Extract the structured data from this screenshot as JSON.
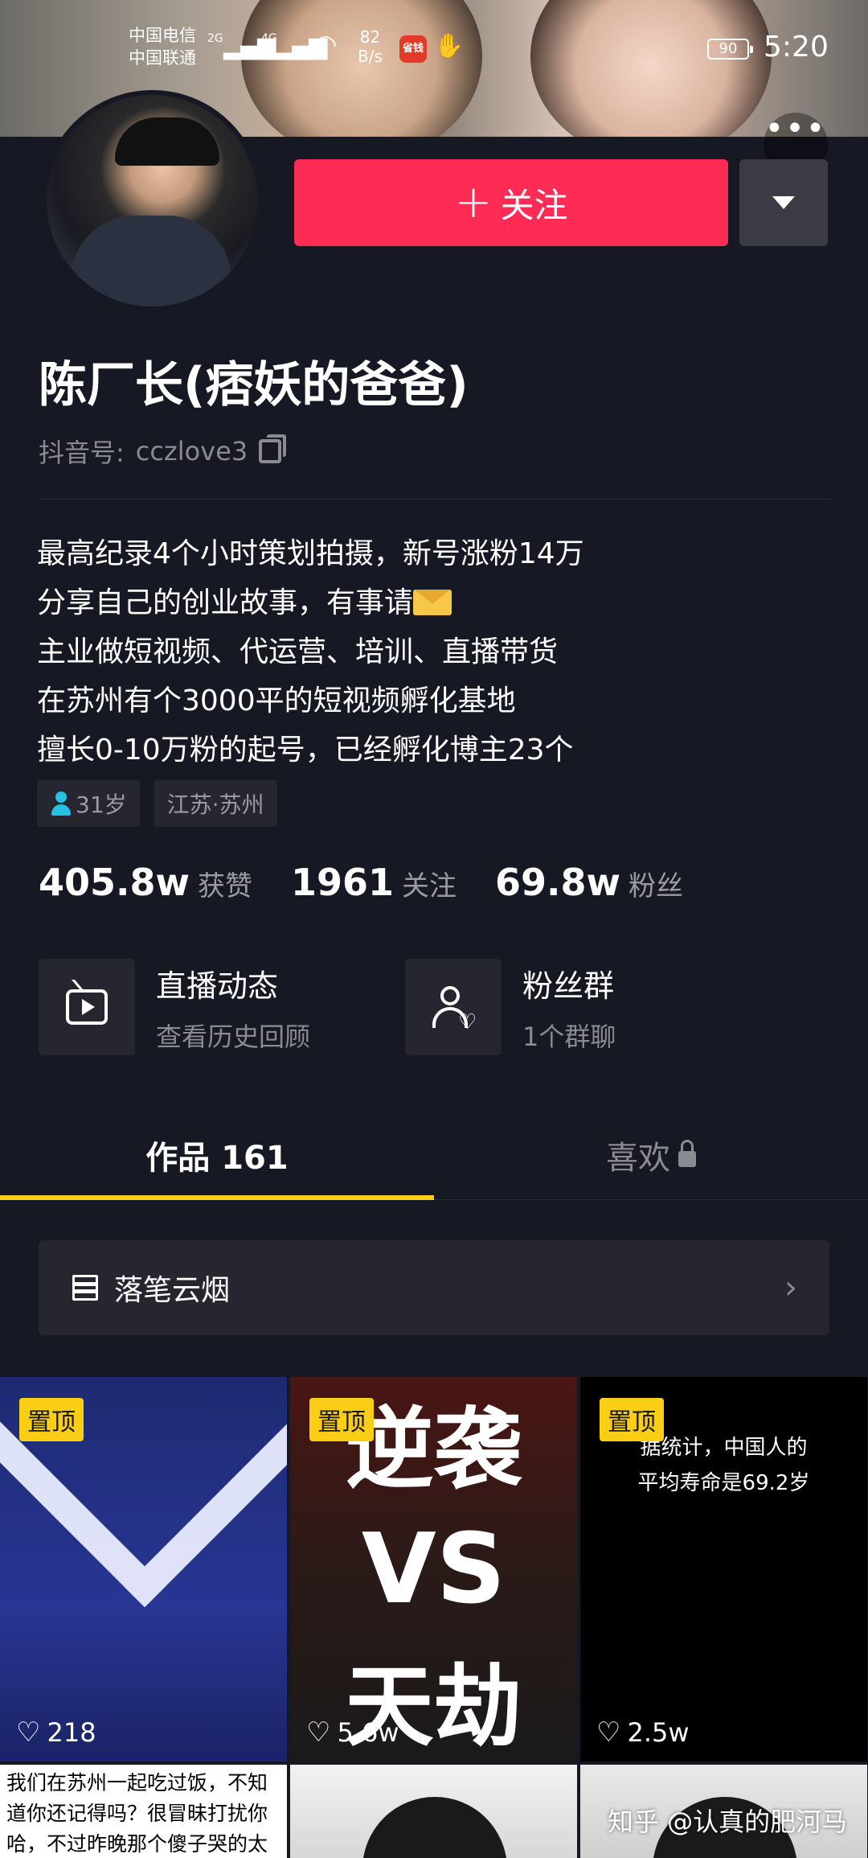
{
  "status_bar": {
    "carrier_1": "中国电信",
    "carrier_2": "中国联通",
    "net_1": "2G",
    "net_2": "4G",
    "speed_value": "82",
    "speed_unit": "B/s",
    "app_badge": "省钱",
    "battery": "90",
    "time": "5:20"
  },
  "profile": {
    "follow_label": "关注",
    "follow_plus": "+",
    "name": "陈厂长(痞妖的爸爸)",
    "douyin_id_label": "抖音号:",
    "douyin_id": "cczlove3",
    "bio": [
      "最高纪录4个小时策划拍摄，新号涨粉14万",
      "分享自己的创业故事，有事请",
      "主业做短视频、代运营、培训、直播带货",
      "在苏州有个3000平的短视频孵化基地",
      "擅长0-10万粉的起号，已经孵化博主23个"
    ],
    "tags": {
      "age": "31岁",
      "location": "江苏·苏州"
    },
    "stats": [
      {
        "value": "405.8w",
        "label": "获赞"
      },
      {
        "value": "1961",
        "label": "关注"
      },
      {
        "value": "69.8w",
        "label": "粉丝"
      }
    ],
    "features": [
      {
        "title": "直播动态",
        "subtitle": "查看历史回顾"
      },
      {
        "title": "粉丝群",
        "subtitle": "1个群聊"
      }
    ]
  },
  "tabs": {
    "works": "作品 161",
    "likes": "喜欢"
  },
  "collection": {
    "label": "落笔云烟"
  },
  "videos": [
    {
      "pinned": "置顶",
      "likes": "218"
    },
    {
      "pinned": "置顶",
      "likes": "5.6w",
      "overlay_1": "逆袭",
      "overlay_2": "VS",
      "overlay_3": "天劫"
    },
    {
      "pinned": "置顶",
      "likes": "2.5w",
      "caption_1": "据统计，中国人的",
      "caption_2": "平均寿命是69.2岁"
    }
  ],
  "row2_text": {
    "line_1": "我们在苏州一起吃过饭，不知",
    "line_2": "道你还记得吗？很冒昧打扰你",
    "line_3": "哈，不过昨晚那个傻子哭的太"
  },
  "watermark": "知乎 @认真的肥河马",
  "colors": {
    "background": "#161823",
    "follow": "#fe2c55",
    "accent_yellow": "#face15"
  }
}
